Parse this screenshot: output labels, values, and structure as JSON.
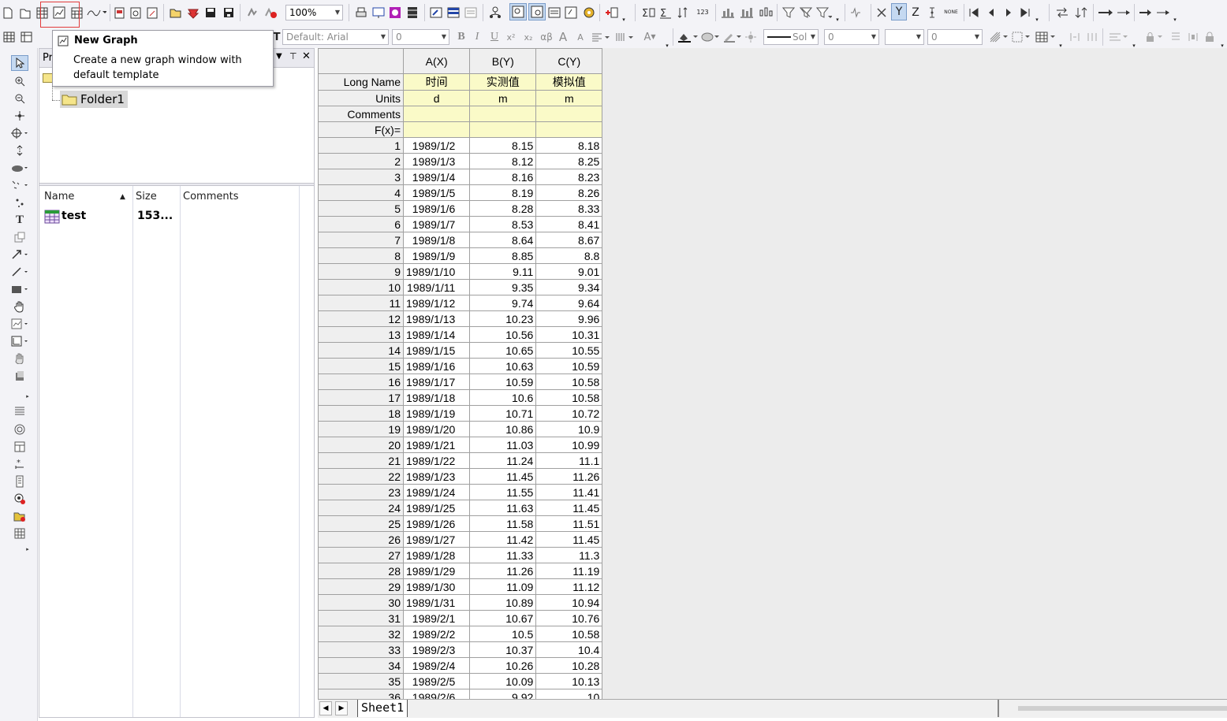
{
  "toolbar": {
    "zoom_value": "100%",
    "font_value": "Default: Arial",
    "font_size_value": "0",
    "line_style_value": "Sol",
    "line_width_value": "0",
    "value_box_2": "0",
    "text_labels": {
      "bold": "B",
      "italic": "I",
      "underline": "U",
      "superscript": "x²",
      "subscript": "x₂",
      "greek": "αβ",
      "grow": "A",
      "shrink": "A",
      "y_button": "Y",
      "z_button": "Z",
      "none_button": "NONE",
      "numeric_123": "123"
    }
  },
  "tooltip": {
    "title": "New Graph",
    "body": "Create a new graph window with default template"
  },
  "project_explorer": {
    "title_fragment": "Pr",
    "tree_folder": "Folder1",
    "columns": {
      "name": "Name",
      "size": "Size",
      "comments": "Comments"
    },
    "items": [
      {
        "name": "test",
        "size": "153..."
      }
    ]
  },
  "worksheet": {
    "columns": [
      "A(X)",
      "B(Y)",
      "C(Y)"
    ],
    "label_rows": {
      "long_name": {
        "label": "Long Name",
        "values": [
          "时间",
          "实测值",
          "模拟值"
        ]
      },
      "units": {
        "label": "Units",
        "values": [
          "d",
          "m",
          "m"
        ]
      },
      "comments": {
        "label": "Comments",
        "values": [
          "",
          "",
          ""
        ]
      },
      "fx": {
        "label": "F(x)=",
        "values": [
          "",
          "",
          ""
        ]
      }
    },
    "rows": [
      {
        "n": "1",
        "a": "1989/1/2",
        "b": "8.15",
        "c": "8.18"
      },
      {
        "n": "2",
        "a": "1989/1/3",
        "b": "8.12",
        "c": "8.25"
      },
      {
        "n": "3",
        "a": "1989/1/4",
        "b": "8.16",
        "c": "8.23"
      },
      {
        "n": "4",
        "a": "1989/1/5",
        "b": "8.19",
        "c": "8.26"
      },
      {
        "n": "5",
        "a": "1989/1/6",
        "b": "8.28",
        "c": "8.33"
      },
      {
        "n": "6",
        "a": "1989/1/7",
        "b": "8.53",
        "c": "8.41"
      },
      {
        "n": "7",
        "a": "1989/1/8",
        "b": "8.64",
        "c": "8.67"
      },
      {
        "n": "8",
        "a": "1989/1/9",
        "b": "8.85",
        "c": "8.8"
      },
      {
        "n": "9",
        "a": "1989/1/10",
        "b": "9.11",
        "c": "9.01"
      },
      {
        "n": "10",
        "a": "1989/1/11",
        "b": "9.35",
        "c": "9.34"
      },
      {
        "n": "11",
        "a": "1989/1/12",
        "b": "9.74",
        "c": "9.64"
      },
      {
        "n": "12",
        "a": "1989/1/13",
        "b": "10.23",
        "c": "9.96"
      },
      {
        "n": "13",
        "a": "1989/1/14",
        "b": "10.56",
        "c": "10.31"
      },
      {
        "n": "14",
        "a": "1989/1/15",
        "b": "10.65",
        "c": "10.55"
      },
      {
        "n": "15",
        "a": "1989/1/16",
        "b": "10.63",
        "c": "10.59"
      },
      {
        "n": "16",
        "a": "1989/1/17",
        "b": "10.59",
        "c": "10.58"
      },
      {
        "n": "17",
        "a": "1989/1/18",
        "b": "10.6",
        "c": "10.58"
      },
      {
        "n": "18",
        "a": "1989/1/19",
        "b": "10.71",
        "c": "10.72"
      },
      {
        "n": "19",
        "a": "1989/1/20",
        "b": "10.86",
        "c": "10.9"
      },
      {
        "n": "20",
        "a": "1989/1/21",
        "b": "11.03",
        "c": "10.99"
      },
      {
        "n": "21",
        "a": "1989/1/22",
        "b": "11.24",
        "c": "11.1"
      },
      {
        "n": "22",
        "a": "1989/1/23",
        "b": "11.45",
        "c": "11.26"
      },
      {
        "n": "23",
        "a": "1989/1/24",
        "b": "11.55",
        "c": "11.41"
      },
      {
        "n": "24",
        "a": "1989/1/25",
        "b": "11.63",
        "c": "11.45"
      },
      {
        "n": "25",
        "a": "1989/1/26",
        "b": "11.58",
        "c": "11.51"
      },
      {
        "n": "26",
        "a": "1989/1/27",
        "b": "11.42",
        "c": "11.45"
      },
      {
        "n": "27",
        "a": "1989/1/28",
        "b": "11.33",
        "c": "11.3"
      },
      {
        "n": "28",
        "a": "1989/1/29",
        "b": "11.26",
        "c": "11.19"
      },
      {
        "n": "29",
        "a": "1989/1/30",
        "b": "11.09",
        "c": "11.12"
      },
      {
        "n": "30",
        "a": "1989/1/31",
        "b": "10.89",
        "c": "10.94"
      },
      {
        "n": "31",
        "a": "1989/2/1",
        "b": "10.67",
        "c": "10.76"
      },
      {
        "n": "32",
        "a": "1989/2/2",
        "b": "10.5",
        "c": "10.58"
      },
      {
        "n": "33",
        "a": "1989/2/3",
        "b": "10.37",
        "c": "10.4"
      },
      {
        "n": "34",
        "a": "1989/2/4",
        "b": "10.26",
        "c": "10.28"
      },
      {
        "n": "35",
        "a": "1989/2/5",
        "b": "10.09",
        "c": "10.13"
      },
      {
        "n": "36",
        "a": "1989/2/6",
        "b": "9.92",
        "c": "10"
      }
    ],
    "sheet_tab": "Sheet1"
  },
  "colors": {
    "label_row_bg": "#fafac8",
    "header_bg": "#efefef",
    "highlight_border": "#e23b3b",
    "folder_yellow": "#f5e58a"
  }
}
